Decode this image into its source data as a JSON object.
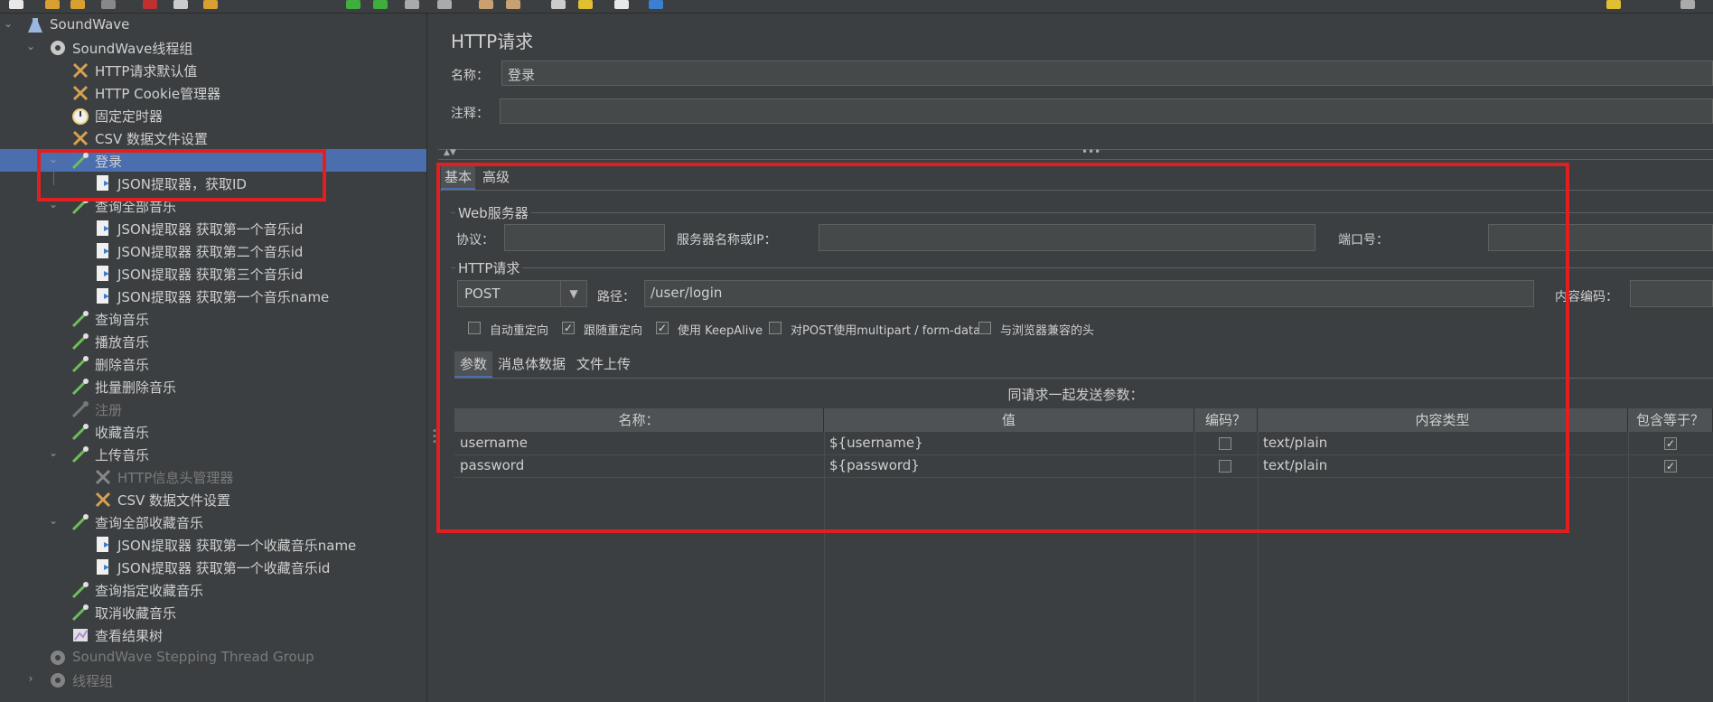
{
  "colors": {
    "highlight": "#e02020",
    "selection": "#4b6eaf"
  },
  "tree": {
    "items": [
      {
        "label": "SoundWave",
        "icon": "test-plan-icon"
      },
      {
        "label": "SoundWave线程组",
        "icon": "gear-icon"
      },
      {
        "label": "HTTP请求默认值",
        "icon": "wrench-icon"
      },
      {
        "label": "HTTP Cookie管理器",
        "icon": "wrench-icon"
      },
      {
        "label": "固定定时器",
        "icon": "timer-icon"
      },
      {
        "label": "CSV 数据文件设置",
        "icon": "wrench-icon"
      },
      {
        "label": "登录",
        "icon": "sampler-icon"
      },
      {
        "label": "JSON提取器，获取ID",
        "icon": "extractor-icon"
      },
      {
        "label": "查询全部音乐",
        "icon": "sampler-icon"
      },
      {
        "label": "JSON提取器 获取第一个音乐id",
        "icon": "extractor-icon"
      },
      {
        "label": "JSON提取器 获取第二个音乐id",
        "icon": "extractor-icon"
      },
      {
        "label": "JSON提取器 获取第三个音乐id",
        "icon": "extractor-icon"
      },
      {
        "label": "JSON提取器 获取第一个音乐name",
        "icon": "extractor-icon"
      },
      {
        "label": "查询音乐",
        "icon": "sampler-icon"
      },
      {
        "label": "播放音乐",
        "icon": "sampler-icon"
      },
      {
        "label": "删除音乐",
        "icon": "sampler-icon"
      },
      {
        "label": "批量删除音乐",
        "icon": "sampler-icon"
      },
      {
        "label": "注册",
        "icon": "sampler-icon"
      },
      {
        "label": "收藏音乐",
        "icon": "sampler-icon"
      },
      {
        "label": "上传音乐",
        "icon": "sampler-icon"
      },
      {
        "label": "HTTP信息头管理器",
        "icon": "wrench-icon"
      },
      {
        "label": "CSV 数据文件设置",
        "icon": "wrench-icon"
      },
      {
        "label": "查询全部收藏音乐",
        "icon": "sampler-icon"
      },
      {
        "label": "JSON提取器 获取第一个收藏音乐name",
        "icon": "extractor-icon"
      },
      {
        "label": "JSON提取器 获取第一个收藏音乐id",
        "icon": "extractor-icon"
      },
      {
        "label": "查询指定收藏音乐",
        "icon": "sampler-icon"
      },
      {
        "label": "取消收藏音乐",
        "icon": "sampler-icon"
      },
      {
        "label": "查看结果树",
        "icon": "listener-icon"
      },
      {
        "label": "SoundWave Stepping Thread Group",
        "icon": "gear-icon"
      },
      {
        "label": "线程组",
        "icon": "gear-icon"
      }
    ]
  },
  "panel": {
    "title": "HTTP请求",
    "name_label": "名称：",
    "name_value": "登录",
    "comment_label": "注释：",
    "comment_value": "",
    "tabs": [
      "基本",
      "高级"
    ],
    "web_server": {
      "legend": "Web服务器",
      "protocol_label": "协议：",
      "protocol_value": "",
      "server_label": "服务器名称或IP：",
      "server_value": "",
      "port_label": "端口号：",
      "port_value": ""
    },
    "http_request": {
      "legend": "HTTP请求",
      "method": "POST",
      "path_label": "路径：",
      "path_value": "/user/login",
      "encoding_label": "内容编码：",
      "encoding_value": ""
    },
    "checkboxes": [
      {
        "label": "自动重定向",
        "checked": false
      },
      {
        "label": "跟随重定向",
        "checked": true
      },
      {
        "label": "使用 KeepAlive",
        "checked": true
      },
      {
        "label": "对POST使用multipart / form-data",
        "checked": false
      },
      {
        "label": "与浏览器兼容的头",
        "checked": false
      }
    ],
    "sub_tabs": [
      "参数",
      "消息体数据",
      "文件上传"
    ],
    "params_caption": "同请求一起发送参数：",
    "table": {
      "headers": [
        "名称：",
        "值",
        "编码？",
        "内容类型",
        "包含等于？"
      ],
      "rows": [
        {
          "name": "username",
          "value": "${username}",
          "encode": false,
          "content_type": "text/plain",
          "include_equals": true
        },
        {
          "name": "password",
          "value": "${password}",
          "encode": false,
          "content_type": "text/plain",
          "include_equals": true
        }
      ]
    }
  }
}
